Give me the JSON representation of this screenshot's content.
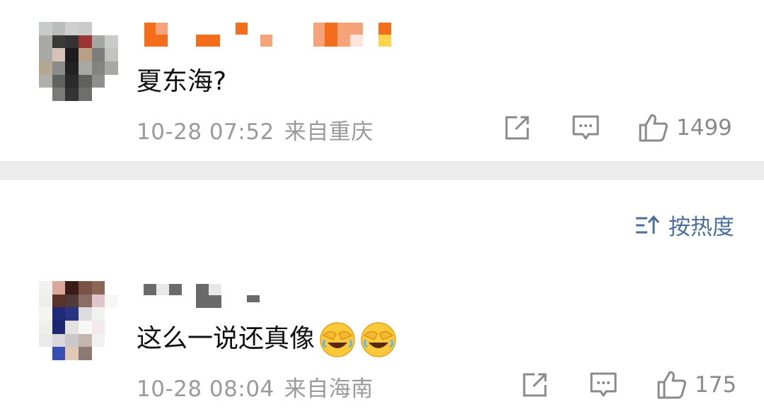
{
  "posts": [
    {
      "text": "夏东海?",
      "time": "10-28 07:52",
      "location": "来自重庆",
      "likes": "1499"
    },
    {
      "text": "这么一说还真像",
      "time": "10-28 08:04",
      "location": "来自海南",
      "likes": "175",
      "emojis": [
        "facepalm-laugh-emoji",
        "facepalm-laugh-emoji"
      ]
    }
  ],
  "sort": {
    "label": "按热度",
    "icon": "sort-icon"
  },
  "colors": {
    "accent": "#4a6f9b",
    "meta": "#9a9a9a",
    "divider": "#ececec",
    "username_orange": "#f07a1e"
  },
  "icons": [
    "share-icon",
    "comment-icon",
    "like-icon"
  ]
}
